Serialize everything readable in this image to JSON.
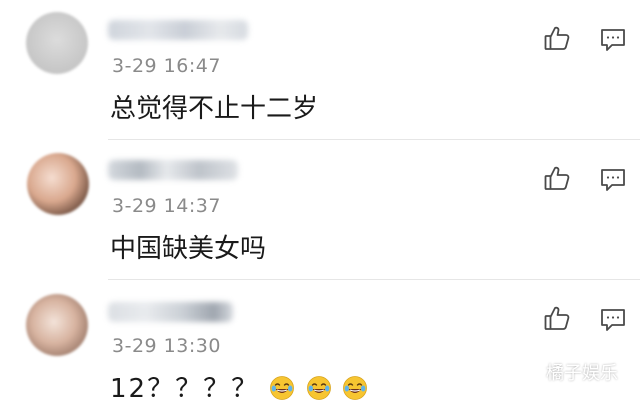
{
  "comments": [
    {
      "time": "3-29 16:47",
      "text": "总觉得不止十二岁",
      "avatar_icon": "blurred-avatar",
      "like_icon": "thumbs-up-icon",
      "reply_icon": "comment-icon"
    },
    {
      "time": "3-29 14:37",
      "text": "中国缺美女吗",
      "avatar_icon": "blurred-avatar",
      "like_icon": "thumbs-up-icon",
      "reply_icon": "comment-icon"
    },
    {
      "time": "3-29 13:30",
      "text_prefix": "12？？？？",
      "emoji": [
        "face-with-tears-of-joy",
        "face-with-tears-of-joy",
        "face-with-tears-of-joy"
      ],
      "avatar_icon": "blurred-avatar",
      "like_icon": "thumbs-up-icon",
      "reply_icon": "comment-icon"
    }
  ],
  "watermark": {
    "text": "橘子娱乐",
    "icon": "wechat-official-account-icon"
  },
  "colors": {
    "time": "#8a8a8a",
    "text": "#1a1a1a",
    "icon": "#4a4a4a",
    "divider": "#e6e6e6"
  }
}
